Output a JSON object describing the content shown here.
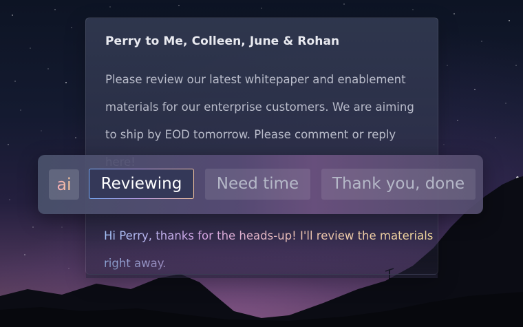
{
  "email": {
    "header": "Perry to Me, Colleen, June & Rohan",
    "body": "Please review our latest whitepaper and enablement materials for our enterprise customers. We are aiming to ship by EOD tomorrow.  Please comment or reply here!",
    "reply_draft": "Hi Perry, thanks for the heads-up!  I'll review the materials right away."
  },
  "suggestions": {
    "badge": "ai",
    "chips": [
      {
        "label": "Reviewing",
        "selected": true
      },
      {
        "label": "Need time",
        "selected": false
      },
      {
        "label": "Thank you, done",
        "selected": false
      }
    ]
  },
  "colors": {
    "accent_gradient": [
      "#7ab0ff",
      "#c8a6f0",
      "#f6c6a0"
    ],
    "badge_text": "#f0a8b8"
  }
}
